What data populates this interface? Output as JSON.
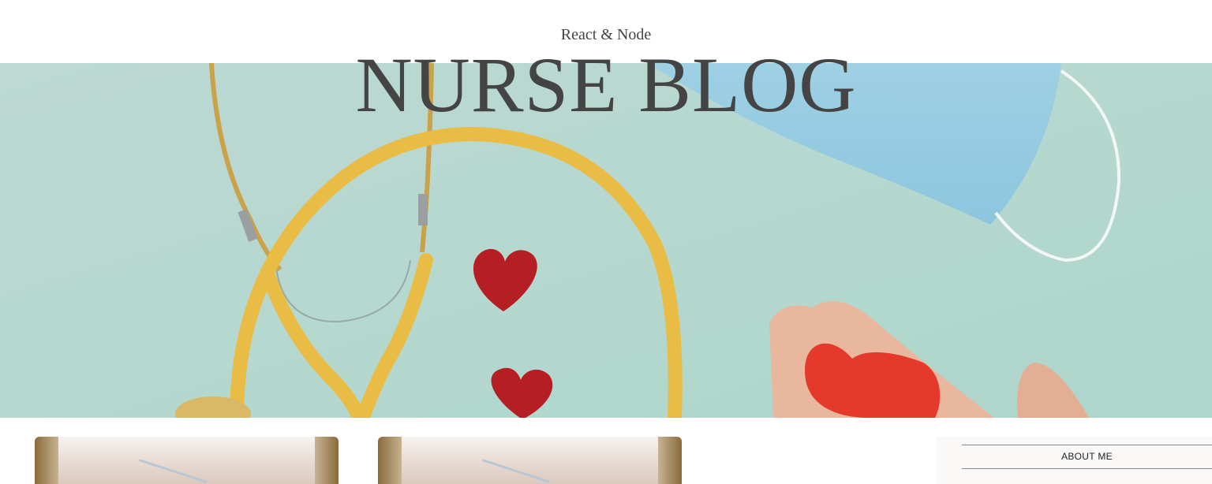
{
  "header": {
    "subtitle": "React & Node",
    "title": "NURSE BLOG"
  },
  "hero": {
    "background_color": "#bcd9d2"
  },
  "posts": [
    {
      "thumbnail": "syringe-window-photo"
    },
    {
      "thumbnail": "syringe-window-photo"
    }
  ],
  "sidebar": {
    "about_title": "ABOUT ME"
  }
}
